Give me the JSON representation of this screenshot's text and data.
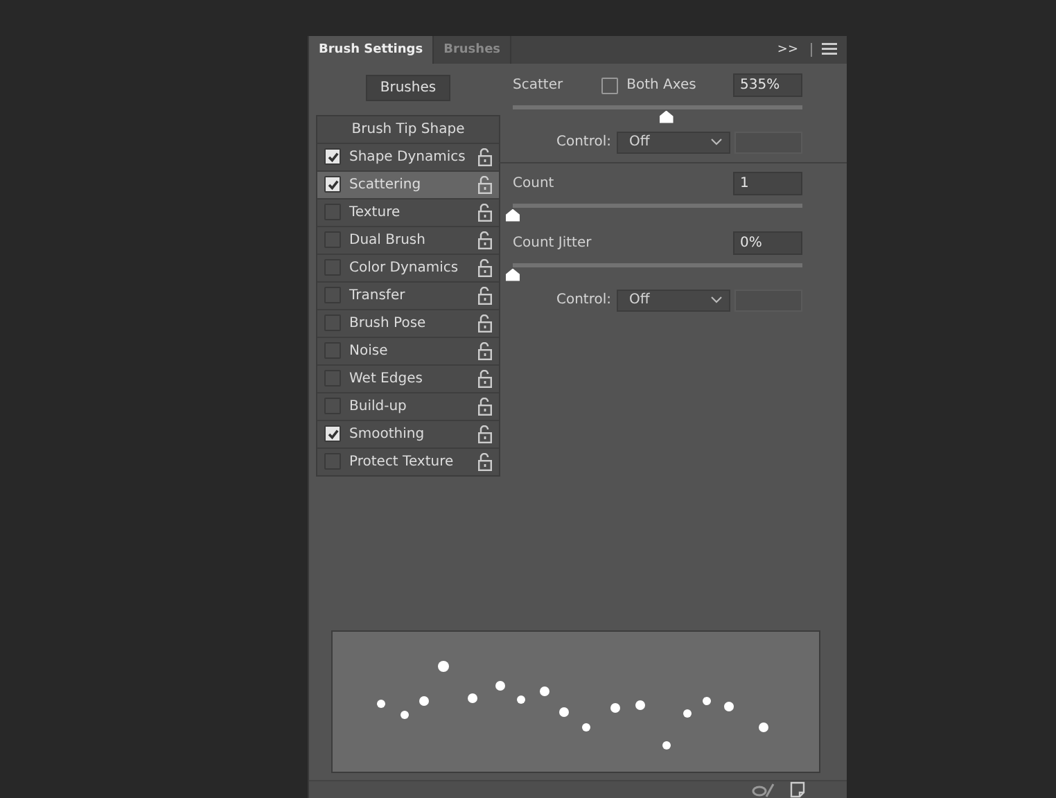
{
  "tabs": [
    {
      "label": "Brush Settings",
      "selected": true
    },
    {
      "label": "Brushes",
      "selected": false
    }
  ],
  "header_icons": {
    "expand": ">>"
  },
  "brushes_button": "Brushes",
  "options": [
    {
      "label": "Brush Tip Shape",
      "kind": "header",
      "selected": false
    },
    {
      "label": "Shape Dynamics",
      "kind": "option",
      "checked": true,
      "selected": false
    },
    {
      "label": "Scattering",
      "kind": "option",
      "checked": true,
      "selected": true
    },
    {
      "label": "Texture",
      "kind": "option",
      "checked": false,
      "selected": false
    },
    {
      "label": "Dual Brush",
      "kind": "option",
      "checked": false,
      "selected": false
    },
    {
      "label": "Color Dynamics",
      "kind": "option",
      "checked": false,
      "selected": false
    },
    {
      "label": "Transfer",
      "kind": "option",
      "checked": false,
      "selected": false
    },
    {
      "label": "Brush Pose",
      "kind": "option",
      "checked": false,
      "selected": false
    },
    {
      "label": "Noise",
      "kind": "option",
      "checked": false,
      "selected": false
    },
    {
      "label": "Wet Edges",
      "kind": "option",
      "checked": false,
      "selected": false
    },
    {
      "label": "Build-up",
      "kind": "option",
      "checked": false,
      "selected": false
    },
    {
      "label": "Smoothing",
      "kind": "option",
      "checked": true,
      "selected": false
    },
    {
      "label": "Protect Texture",
      "kind": "option",
      "checked": false,
      "selected": false
    }
  ],
  "scatter": {
    "label": "Scatter",
    "both_axes": {
      "label": "Both Axes",
      "checked": false
    },
    "value": "535%",
    "level": 0.53,
    "control": {
      "label": "Control:",
      "value": "Off"
    }
  },
  "count": {
    "label": "Count",
    "value": "1",
    "level": 0
  },
  "count_jitter": {
    "label": "Count Jitter",
    "value": "0%",
    "level": 0,
    "control": {
      "label": "Control:",
      "value": "Off"
    }
  }
}
